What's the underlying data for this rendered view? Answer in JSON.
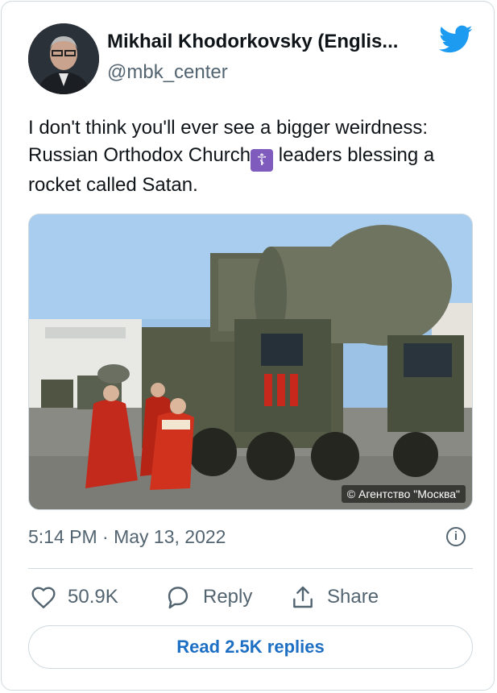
{
  "author": {
    "name": "Mikhail Khodorkovsky (Englis...",
    "handle": "@mbk_center"
  },
  "tweet": {
    "text_part1": "I don't think you'll ever see a bigger weirdness: Russian Orthodox Church",
    "emoji_name": "orthodox-cross-emoji",
    "text_part2": " leaders blessing a rocket called Satan."
  },
  "photo": {
    "credit": "© Агентство \"Москва\""
  },
  "meta": {
    "timestamp": "5:14 PM · May 13, 2022",
    "info_glyph": "i"
  },
  "actions": {
    "likes": "50.9K",
    "reply_label": "Reply",
    "share_label": "Share"
  },
  "footer": {
    "read_replies_label": "Read 2.5K replies"
  },
  "colors": {
    "twitter_blue": "#1d9bf0",
    "link_blue": "#1d6fc4",
    "muted": "#536471",
    "border": "#cfd9de"
  },
  "icons": [
    "twitter-bird-icon",
    "heart-icon",
    "reply-icon",
    "share-icon",
    "info-icon"
  ]
}
